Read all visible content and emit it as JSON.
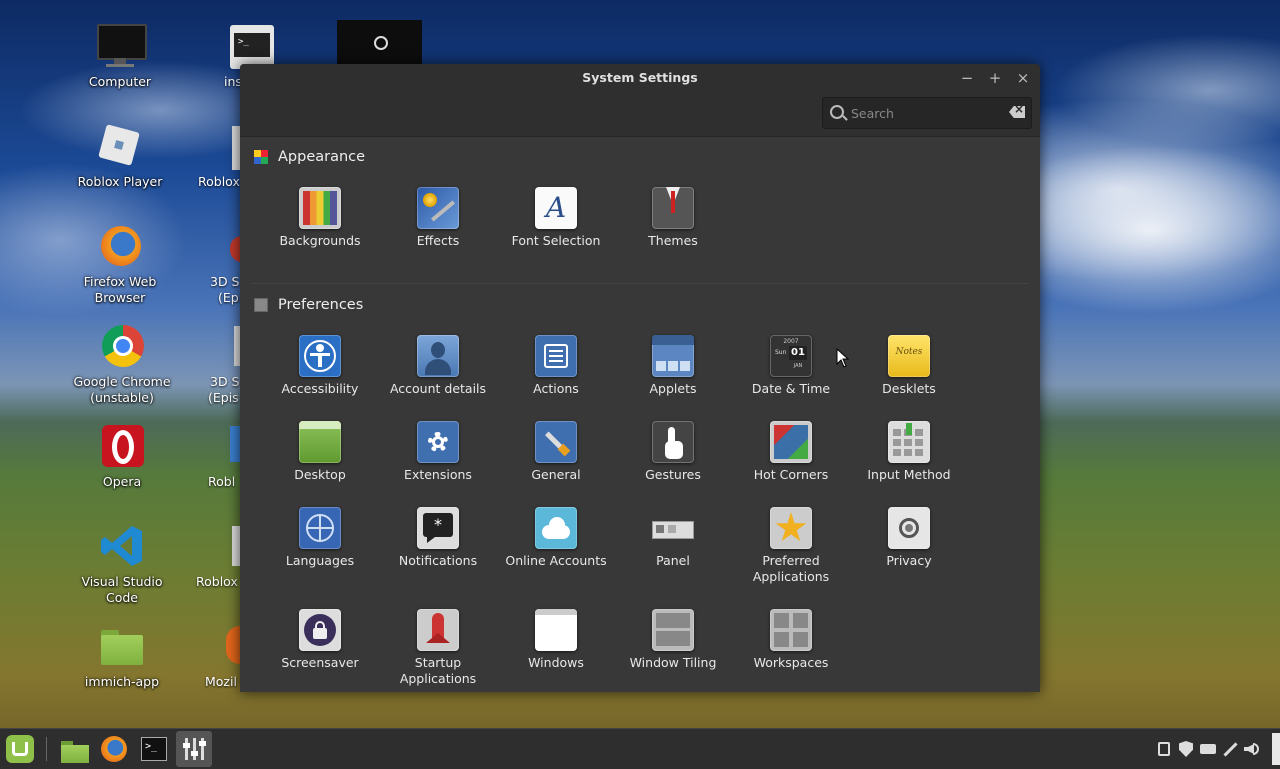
{
  "desktop": {
    "icons": [
      {
        "label": "Computer"
      },
      {
        "label": "Roblox Player"
      },
      {
        "label": "Firefox Web Browser"
      },
      {
        "label": "Google Chrome (unstable)"
      },
      {
        "label": "Opera"
      },
      {
        "label": "Visual Studio Code"
      },
      {
        "label": "immich-app"
      }
    ],
    "partial_labels": [
      "ins",
      "Roblox",
      "3D S",
      "(Epi",
      "3D S",
      "(Epis",
      "Robl",
      "Roblox",
      "Mozil"
    ]
  },
  "window": {
    "title": "System Settings",
    "minimize": "−",
    "maximize": "+",
    "close": "×",
    "search_placeholder": "Search"
  },
  "sections": {
    "appearance": {
      "title": "Appearance",
      "items": [
        {
          "label": "Backgrounds"
        },
        {
          "label": "Effects"
        },
        {
          "label": "Font Selection"
        },
        {
          "label": "Themes"
        }
      ]
    },
    "preferences": {
      "title": "Preferences",
      "items": [
        {
          "label": "Accessibility"
        },
        {
          "label": "Account details"
        },
        {
          "label": "Actions"
        },
        {
          "label": "Applets"
        },
        {
          "label": "Date & Time"
        },
        {
          "label": "Desklets"
        },
        {
          "label": "Desktop"
        },
        {
          "label": "Extensions"
        },
        {
          "label": "General"
        },
        {
          "label": "Gestures"
        },
        {
          "label": "Hot Corners"
        },
        {
          "label": "Input Method"
        },
        {
          "label": "Languages"
        },
        {
          "label": "Notifications"
        },
        {
          "label": "Online Accounts"
        },
        {
          "label": "Panel"
        },
        {
          "label": "Preferred Applications"
        },
        {
          "label": "Privacy"
        },
        {
          "label": "Screensaver"
        },
        {
          "label": "Startup Applications"
        },
        {
          "label": "Windows"
        },
        {
          "label": "Window Tiling"
        },
        {
          "label": "Workspaces"
        }
      ]
    }
  },
  "icon_text": {
    "font_selection": "A",
    "date_year": "2007",
    "date_day": "01",
    "date_month": "JAN",
    "date_weekday": "Sun",
    "desklets_note": "Notes"
  },
  "taskbar": {
    "apps": [
      "mint-menu-icon",
      "files-icon",
      "firefox-icon",
      "terminal-icon",
      "settings-icon"
    ]
  },
  "colors": {
    "window_bg": "#383838",
    "titlebar_bg": "#2f2f2f",
    "taskbar_bg": "#2e2e2e",
    "mint_green": "#8fc04a"
  }
}
